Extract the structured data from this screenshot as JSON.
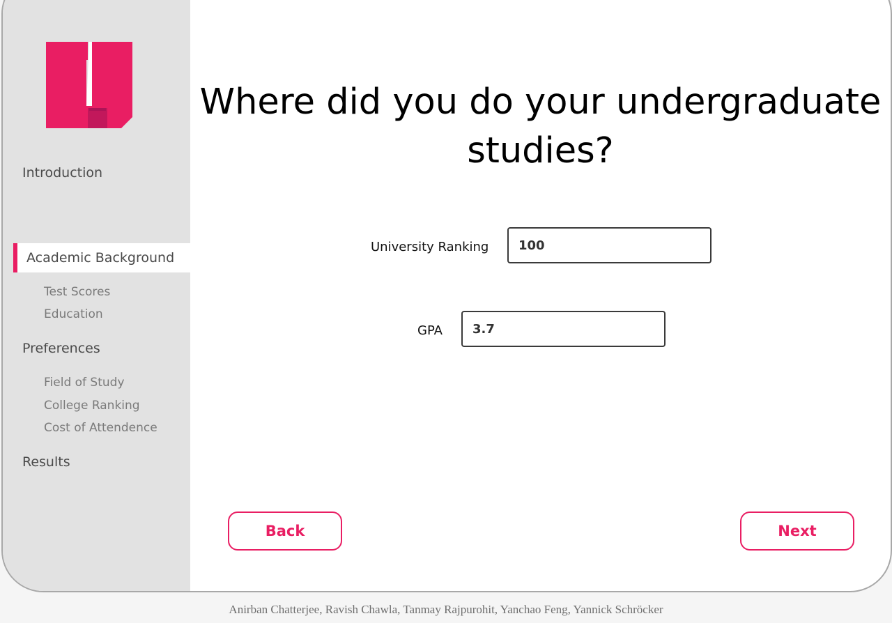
{
  "brand": {
    "logo_icon": "university-u-logo",
    "accent_color": "#e91e63"
  },
  "sidebar": {
    "sections": [
      {
        "label": "Introduction"
      },
      {
        "label": "Academic Background",
        "active": true
      },
      {
        "label": "Preferences"
      },
      {
        "label": "Results"
      }
    ],
    "academic_subitems": [
      "Test Scores",
      "Education"
    ],
    "preferences_subitems": [
      "Field of Study",
      "College Ranking",
      "Cost of Attendence"
    ]
  },
  "main": {
    "question_line1": "Where did you do your undergraduate",
    "question_line2": "studies?",
    "fields": [
      {
        "label": "University Ranking",
        "value": "100"
      },
      {
        "label": "GPA",
        "value": "3.7"
      }
    ]
  },
  "nav_buttons": {
    "back_label": "Back",
    "next_label": "Next"
  },
  "footer": {
    "credits": "Anirban Chatterjee, Ravish Chawla, Tanmay Rajpurohit, Yanchao Feng, Yannick Schröcker"
  }
}
